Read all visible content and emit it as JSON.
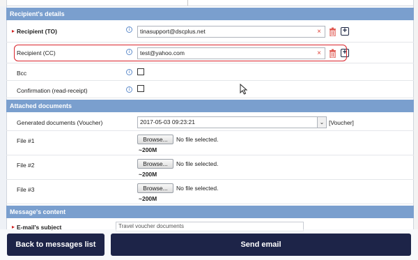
{
  "sections": {
    "recipients": "Recipient's details",
    "attachments": "Attached documents",
    "message": "Message's content"
  },
  "recipients": {
    "to": {
      "label": "Recipient (TO)",
      "value": "tinasupport@dscplus.net"
    },
    "cc": {
      "label": "Recipient (CC)",
      "value": "test@yahoo.com"
    },
    "bcc": {
      "label": "Bcc",
      "checked": false
    },
    "confirmation": {
      "label": "Confirmation (read-receipt)",
      "checked": false
    },
    "info_glyph": "i",
    "clear_glyph": "×",
    "add_glyph": "+",
    "required_glyph": "▸"
  },
  "attachments": {
    "generated": {
      "label": "Generated documents (Voucher)",
      "value": "2017-05-03 09:23:21",
      "tag": "[Voucher]"
    },
    "files": [
      {
        "label": "File #1",
        "browse": "Browse...",
        "status": "No file selected.",
        "size": "~200M"
      },
      {
        "label": "File #2",
        "browse": "Browse...",
        "status": "No file selected.",
        "size": "~200M"
      },
      {
        "label": "File #3",
        "browse": "Browse...",
        "status": "No file selected.",
        "size": "~200M"
      }
    ]
  },
  "message": {
    "subject_label": "E-mail's subject",
    "subject_value": "Travel voucher documents"
  },
  "footer": {
    "back_label": "Back to messages list",
    "send_label": "Send email"
  },
  "colors": {
    "header": "#7a9fce",
    "button": "#1d2448",
    "highlight": "#d9222a"
  }
}
